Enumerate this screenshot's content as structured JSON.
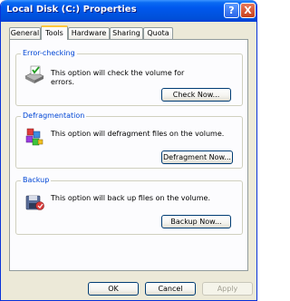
{
  "window": {
    "title": "Local Disk (C:) Properties"
  },
  "titlebar": {
    "help_label": "?",
    "close_label": "X"
  },
  "tabs": [
    {
      "label": "General"
    },
    {
      "label": "Tools"
    },
    {
      "label": "Hardware"
    },
    {
      "label": "Sharing"
    },
    {
      "label": "Quota"
    }
  ],
  "active_tab": "Tools",
  "groups": {
    "error_checking": {
      "title": "Error-checking",
      "text_line1": "This option will check the volume for",
      "text_line2": "errors.",
      "button": "Check Now..."
    },
    "defragmentation": {
      "title": "Defragmentation",
      "text": "This option will defragment files on the volume.",
      "button": "Defragment Now..."
    },
    "backup": {
      "title": "Backup",
      "text": "This option will back up files on the volume.",
      "button": "Backup Now..."
    }
  },
  "footer": {
    "ok": "OK",
    "cancel": "Cancel",
    "apply": "Apply"
  },
  "colors": {
    "title_bar": "#0054e3",
    "group_title": "#0046d5",
    "dialog_bg": "#ece9d8"
  },
  "icons": [
    "disk-check-icon",
    "defragment-icon",
    "backup-icon"
  ]
}
